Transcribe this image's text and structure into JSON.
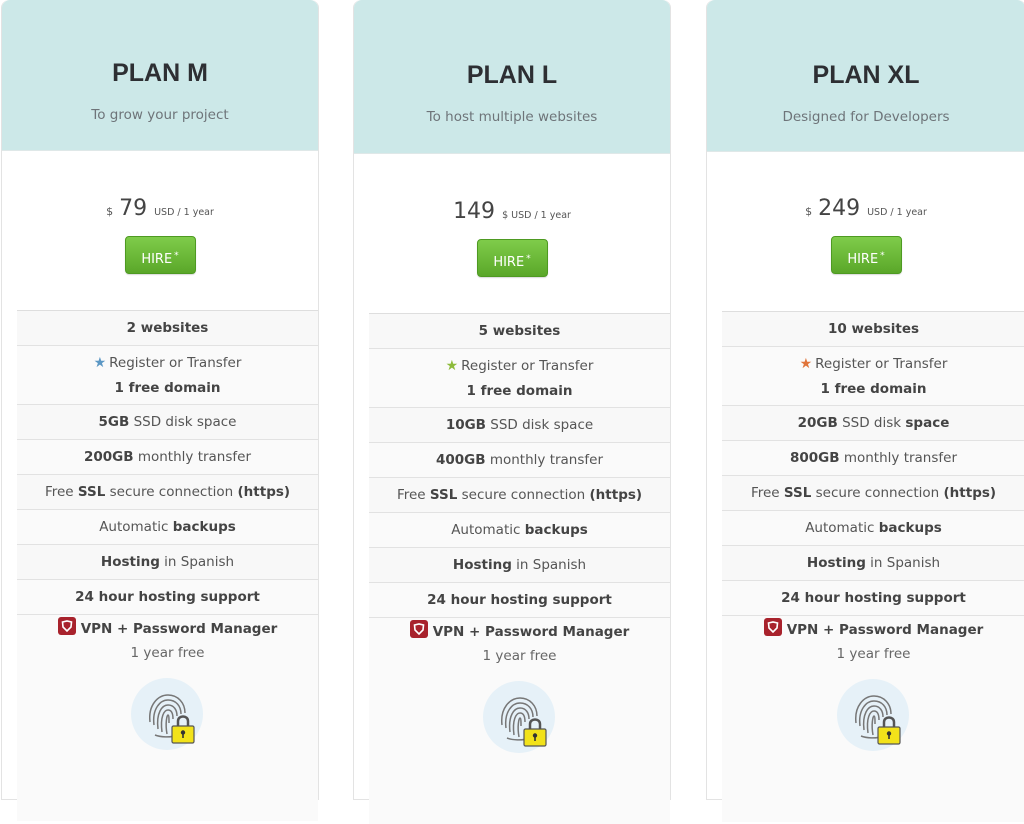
{
  "plans": [
    {
      "id": "m",
      "title": "PLAN M",
      "subtitle": "To grow your project",
      "currency_prefix": "$",
      "amount": "79",
      "period": "USD / 1 year",
      "hire_label": "HIRE",
      "hire_mark": "*",
      "star_color": "#5b97c4",
      "features": {
        "websites": "2 websites",
        "domain_line1": "Register or Transfer",
        "domain_line2": "1 free domain",
        "disk_bold": "5GB",
        "disk_rest": "SSD disk space",
        "transfer_bold": "200GB",
        "transfer_rest": "monthly transfer",
        "ssl_pre": "Free",
        "ssl_bold": "SSL",
        "ssl_mid": "secure connection",
        "ssl_bold2": "(https)",
        "backup_pre": "Automatic",
        "backup_bold": "backups",
        "lang_bold": "Hosting",
        "lang_rest": "in Spanish",
        "support": "24 hour hosting support",
        "vpn": "VPN + Password Manager",
        "vpn_free": "1 year free"
      }
    },
    {
      "id": "l",
      "title": "PLAN L",
      "subtitle": "To host multiple websites",
      "currency_prefix": "",
      "amount": "149",
      "period": "$ USD / 1 year",
      "hire_label": "HIRE",
      "hire_mark": "*",
      "star_color": "#8dbb3a",
      "features": {
        "websites": "5 websites",
        "domain_line1": "Register or Transfer",
        "domain_line2": "1 free domain",
        "disk_bold": "10GB",
        "disk_rest": "SSD disk space",
        "transfer_bold": "400GB",
        "transfer_rest": "monthly transfer",
        "ssl_pre": "Free",
        "ssl_bold": "SSL",
        "ssl_mid": "secure connection",
        "ssl_bold2": "(https)",
        "backup_pre": "Automatic",
        "backup_bold": "backups",
        "lang_bold": "Hosting",
        "lang_rest": "in Spanish",
        "support": "24 hour hosting support",
        "vpn": "VPN + Password Manager",
        "vpn_free": "1 year free"
      }
    },
    {
      "id": "xl",
      "title": "PLAN XL",
      "subtitle": "Designed for Developers",
      "currency_prefix": "$",
      "amount": "249",
      "period": "USD / 1 year",
      "hire_label": "HIRE",
      "hire_mark": "*",
      "star_color": "#e0743a",
      "features": {
        "websites": "10 websites",
        "domain_line1": "Register or Transfer",
        "domain_line2": "1 free domain",
        "disk_bold": "20GB",
        "disk_rest": "SSD disk",
        "disk_bold2": "space",
        "transfer_bold": "800GB",
        "transfer_rest": "monthly transfer",
        "ssl_pre": "Free",
        "ssl_bold": "SSL",
        "ssl_mid": "secure connection",
        "ssl_bold2": "(https)",
        "backup_pre": "Automatic",
        "backup_bold": "backups",
        "lang_bold": "Hosting",
        "lang_rest": "in Spanish",
        "support": "24 hour hosting support",
        "vpn": "VPN + Password Manager",
        "vpn_free": "1 year free"
      }
    }
  ],
  "colors": {
    "header_bg": "#cce8e8",
    "hire_green": "#6bb935",
    "vpn_red": "#a8222c",
    "lock_yellow": "#f2e21a"
  }
}
